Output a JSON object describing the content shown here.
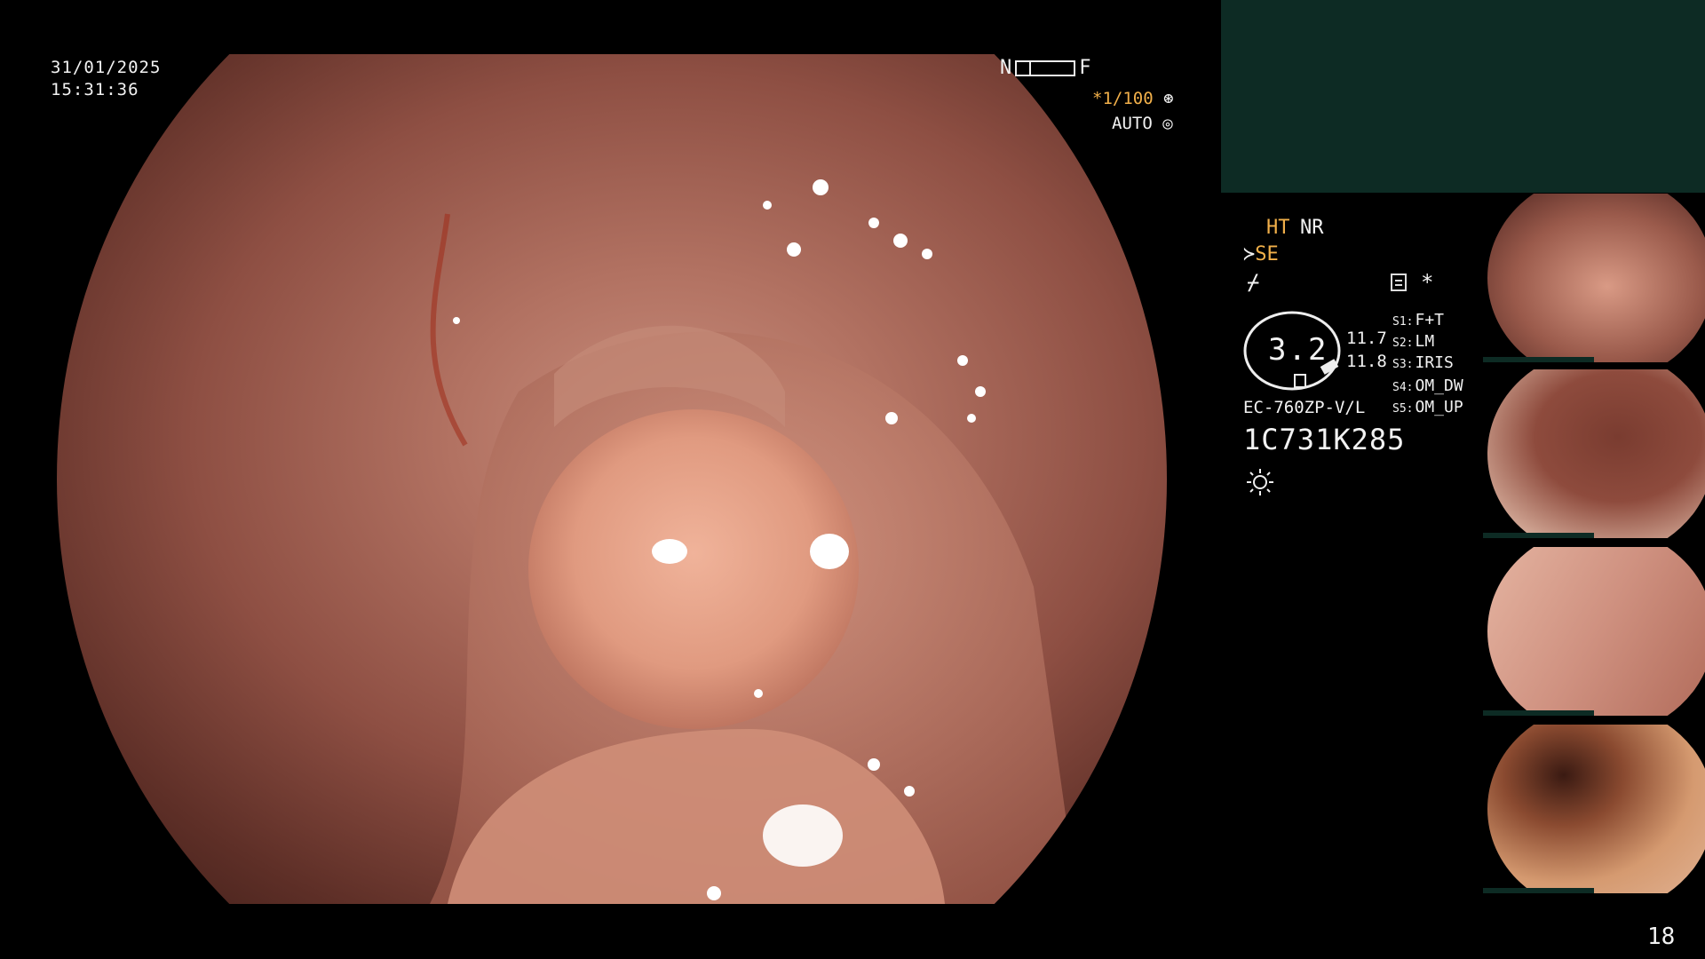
{
  "overlay": {
    "date": "31/01/2025",
    "time": "15:31:36",
    "near_label": "N",
    "far_label": "F",
    "shutter": "*1/100",
    "iris_mode": "AUTO"
  },
  "info": {
    "ht_label": "HT",
    "nr_label": "NR",
    "se_label": "SE",
    "dial_value": "3.2",
    "dial_value_a": "11.7",
    "dial_value_b": "11.8",
    "model": "EC-760ZP-V/L",
    "serial": "1C731K285",
    "switches": [
      {
        "key": "S1:",
        "value": "F+T"
      },
      {
        "key": "S2:",
        "value": "LM"
      },
      {
        "key": "S3:",
        "value": "IRIS"
      },
      {
        "key": "S4:",
        "value": "OM_DW"
      },
      {
        "key": "S5:",
        "value": "OM_UP"
      }
    ]
  },
  "page_number": "18",
  "colors": {
    "accent_orange": "#f2b04a",
    "panel_green": "#0d2b24",
    "text": "#f2f2f2"
  }
}
